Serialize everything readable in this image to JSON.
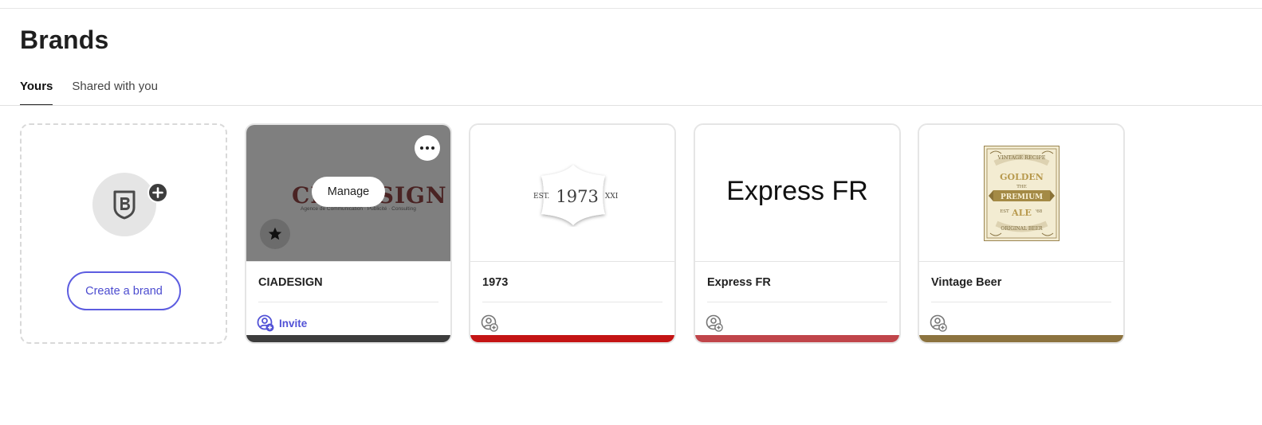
{
  "page": {
    "title": "Brands"
  },
  "tabs": [
    {
      "label": "Yours",
      "active": true
    },
    {
      "label": "Shared with you",
      "active": false
    }
  ],
  "create_card": {
    "button_label": "Create a brand",
    "icon": "brand-add-icon"
  },
  "colors": {
    "accent": "#5c5ce0",
    "invite_text": "#5252d6"
  },
  "brands": [
    {
      "name": "CIADESIGN",
      "invite_label": "Invite",
      "hover": true,
      "manage_label": "Manage",
      "logo_text": "CIADESIGN",
      "logo_subtext": "Agence de Communication · Publicité · Consulting",
      "color_bar": "#3d3d3d"
    },
    {
      "name": "1973",
      "logo": {
        "prefix": "EST.",
        "main": "1973",
        "suffix": "XXI"
      },
      "color_bar": "#c41414"
    },
    {
      "name": "Express FR",
      "logo_text": "Express FR",
      "color_bar": "#c0454a"
    },
    {
      "name": "Vintage Beer",
      "logo": {
        "top": "VINTAGE RECIPE",
        "line1": "GOLDEN",
        "mid": "THE",
        "ribbon": "PREMIUM",
        "est": "EST",
        "year": "'68",
        "line2": "ALE",
        "bottom": "ORIGINAL BEER"
      },
      "color_bar": "#8c733f"
    }
  ]
}
